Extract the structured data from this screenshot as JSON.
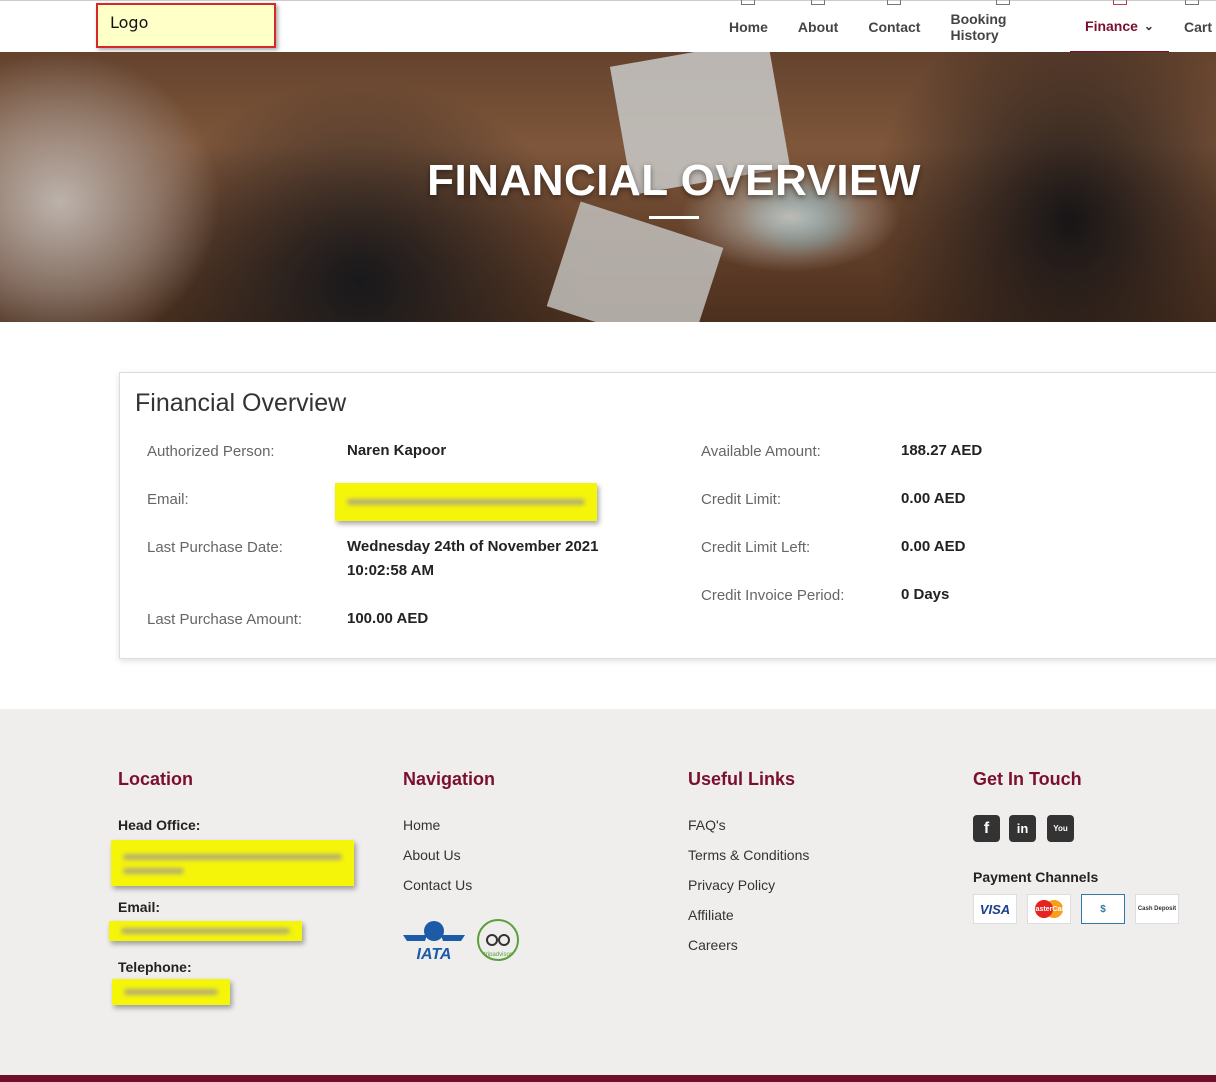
{
  "header": {
    "logo_text": "Logo",
    "nav": [
      {
        "label": "Home"
      },
      {
        "label": "About"
      },
      {
        "label": "Contact"
      },
      {
        "label": "Booking History"
      },
      {
        "label": "Finance",
        "active": true
      },
      {
        "label": "Cart"
      }
    ]
  },
  "hero": {
    "title": "FINANCIAL OVERVIEW"
  },
  "overview": {
    "title": "Financial Overview",
    "left": [
      {
        "label": "Authorized Person:",
        "value": "Naren Kapoor"
      },
      {
        "label": "Email:",
        "value": ""
      },
      {
        "label": "Last Purchase Date:",
        "value": "Wednesday 24th of November 2021",
        "value2": "10:02:58 AM"
      },
      {
        "label": "Last Purchase Amount:",
        "value": "100.00 AED"
      }
    ],
    "right": [
      {
        "label": "Available Amount:",
        "value": "188.27 AED"
      },
      {
        "label": "Credit Limit:",
        "value": "0.00 AED"
      },
      {
        "label": "Credit Limit Left:",
        "value": "0.00 AED"
      },
      {
        "label": "Credit Invoice Period:",
        "value": "0 Days"
      }
    ]
  },
  "footer": {
    "location": {
      "heading": "Location",
      "head_office_label": "Head Office:",
      "email_label": "Email:",
      "telephone_label": "Telephone:"
    },
    "navigation": {
      "heading": "Navigation",
      "links": [
        "Home",
        "About Us",
        "Contact Us"
      ],
      "badges": {
        "iata": "IATA",
        "tripadvisor": "tripadvisor"
      }
    },
    "useful_links": {
      "heading": "Useful Links",
      "links": [
        "FAQ's",
        "Terms & Conditions",
        "Privacy Policy",
        "Affiliate",
        "Careers"
      ]
    },
    "contact": {
      "heading": "Get In Touch",
      "social": [
        {
          "icon": "facebook-icon",
          "glyph": "f"
        },
        {
          "icon": "linkedin-icon",
          "glyph": "in"
        },
        {
          "icon": "youtube-icon",
          "glyph": "You"
        }
      ],
      "payment_label": "Payment Channels",
      "payments": [
        "VISA",
        "MasterCard",
        "$",
        "Cash Deposit"
      ]
    }
  },
  "colors": {
    "brand": "#7a0f2e",
    "highlight": "#f5f50a",
    "footer_bg": "#efeeed"
  }
}
